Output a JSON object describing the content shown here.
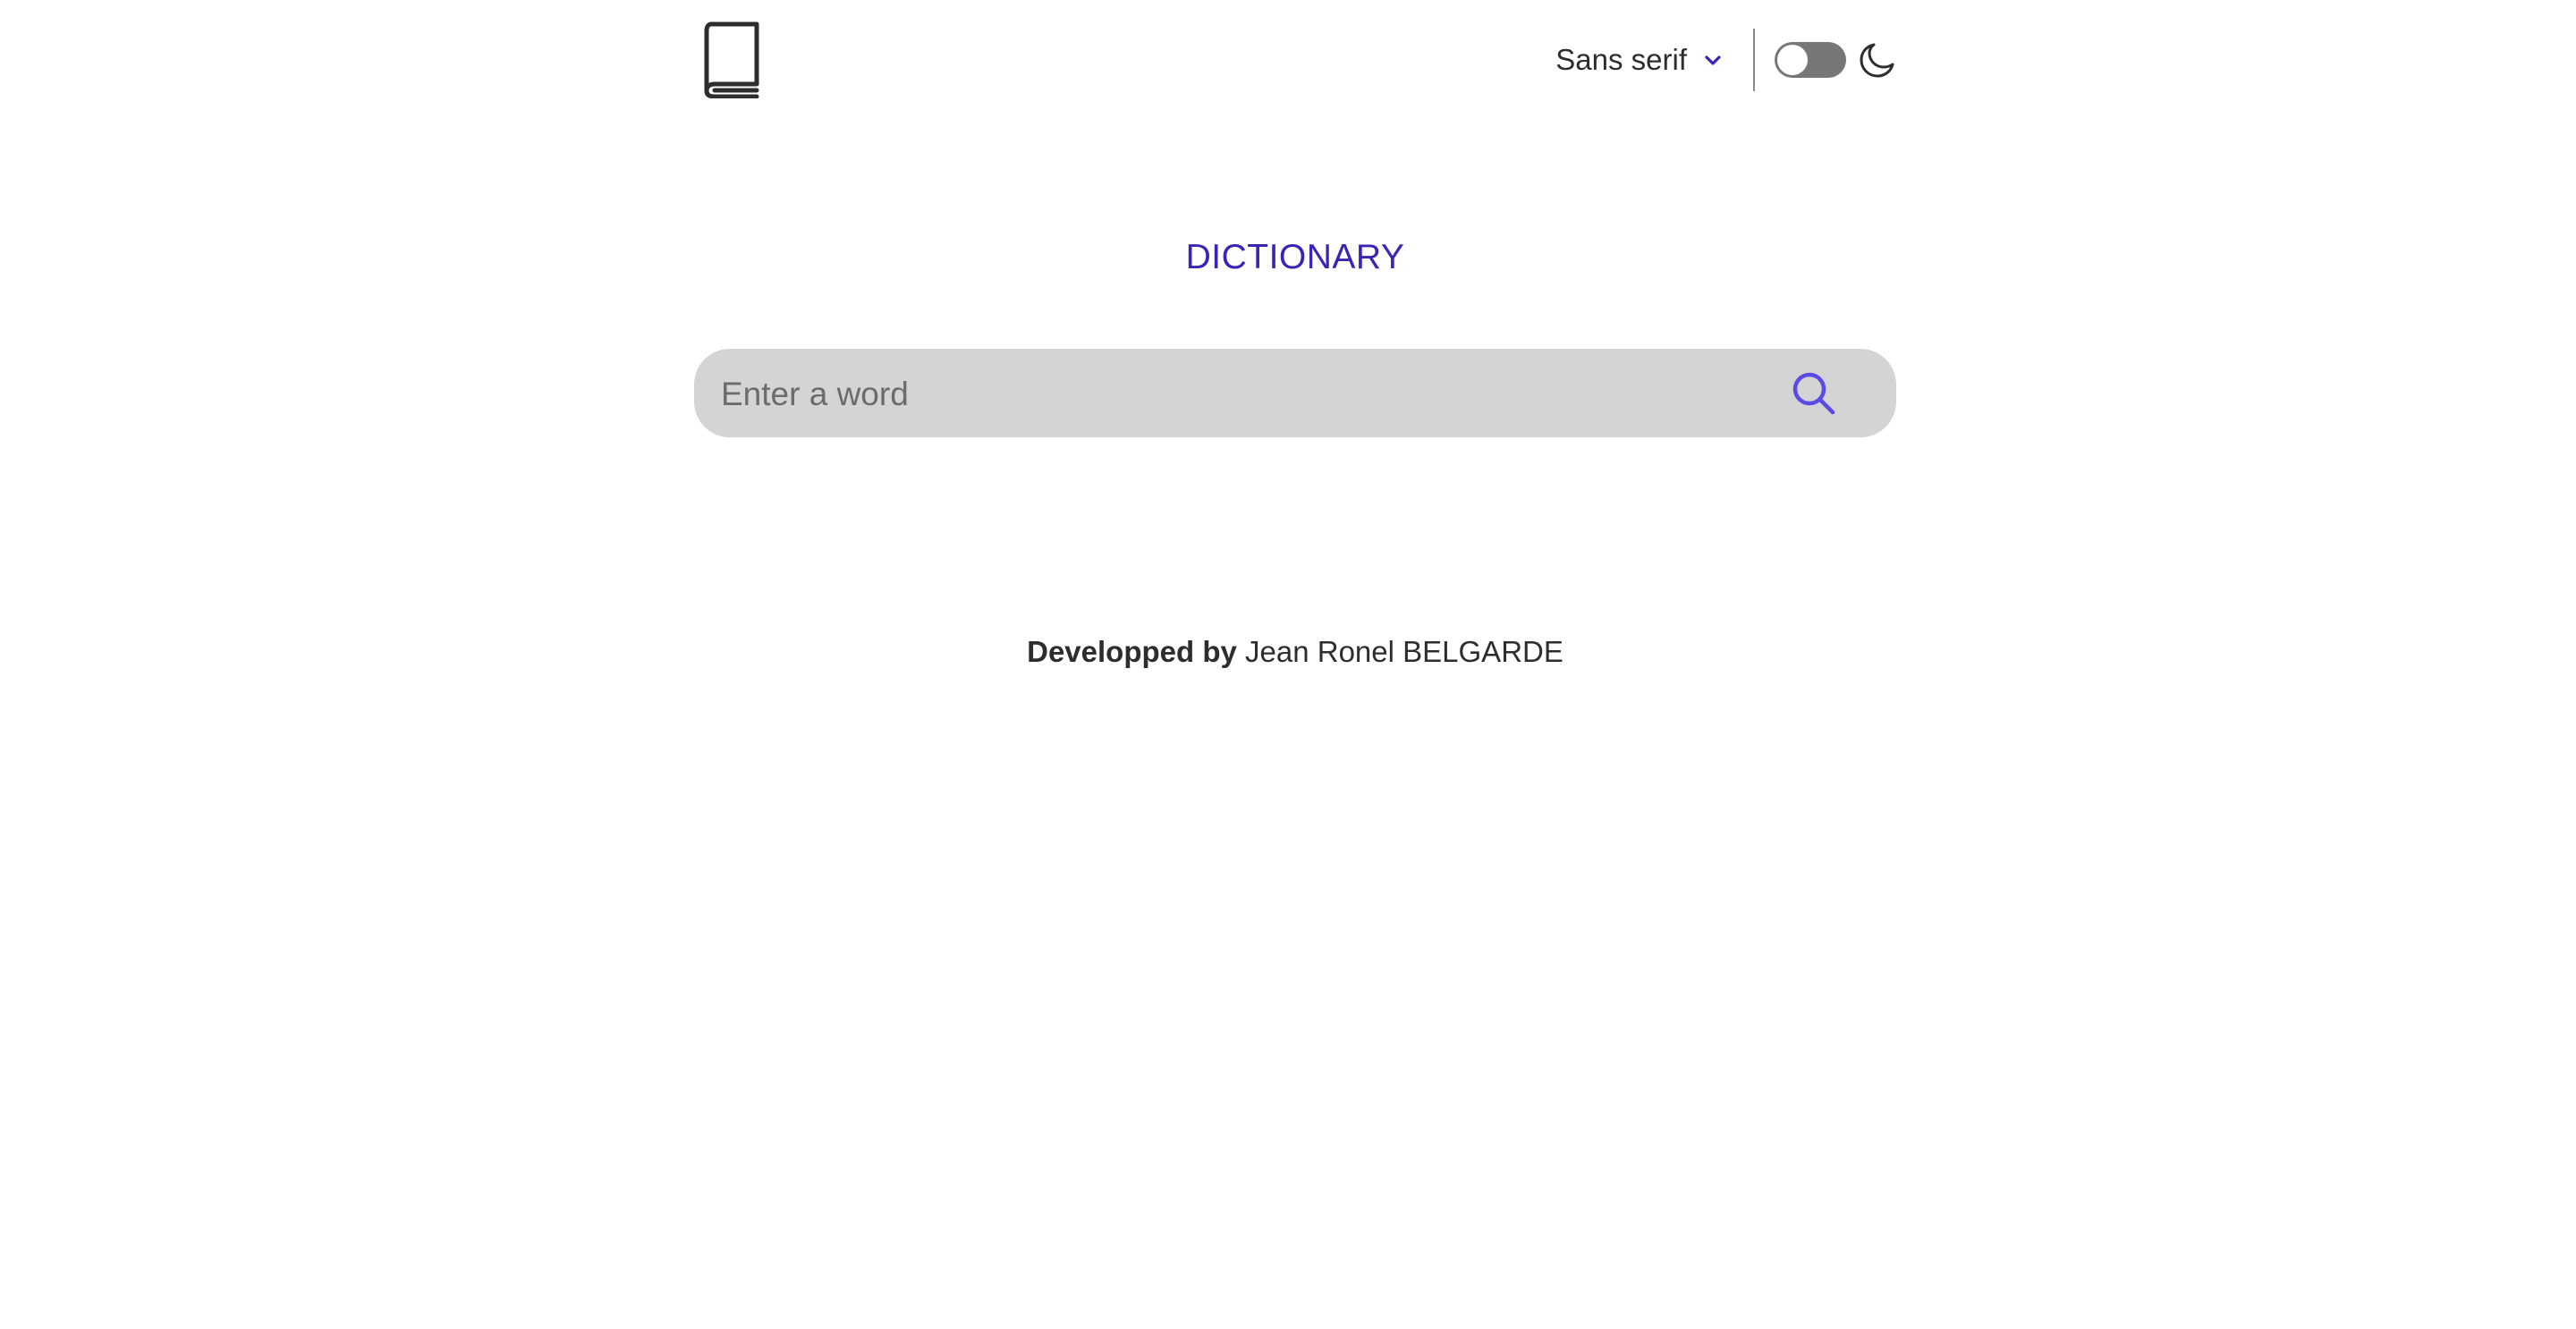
{
  "header": {
    "logo_icon": "book-icon",
    "font_selector": {
      "selected": "Sans serif",
      "icon": "chevron-down-icon"
    },
    "theme_toggle": {
      "state": "off",
      "icon": "moon-icon"
    }
  },
  "main": {
    "title": "DICTIONARY",
    "search": {
      "placeholder": "Enter a word",
      "value": "",
      "icon": "search-icon"
    }
  },
  "footer": {
    "prefix": "Developped by",
    "author": "Jean Ronel BELGARDE"
  },
  "colors": {
    "accent": "#3b23b5",
    "search_icon": "#5b4be6",
    "search_bg": "#d4d4d4",
    "text": "#2d2d2d",
    "toggle_bg": "#777777"
  }
}
